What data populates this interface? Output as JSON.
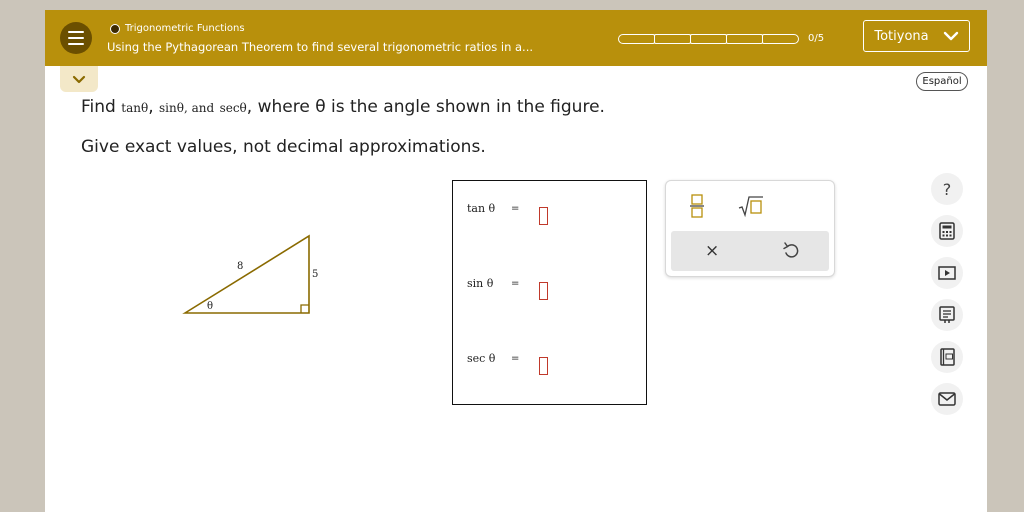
{
  "header": {
    "topic": "Trigonometric Functions",
    "lesson_title": "Using the Pythagorean Theorem to find several trigonometric ratios in a...",
    "progress_text": "0/5",
    "progress_segments": 5,
    "progress_completed": 0,
    "user_name": "Totiyona"
  },
  "language_button": "Español",
  "question": {
    "find": "Find",
    "tan": "tanθ",
    "sep1": ",",
    "sin": "sinθ",
    "and": ", and",
    "sec": "secθ",
    "rest": ", where θ is the angle shown in the figure.",
    "line2": "Give exact values, not decimal approximations."
  },
  "figure": {
    "hypotenuse_label": "8",
    "opposite_label": "5",
    "angle_label": "θ"
  },
  "answers": {
    "tan_label": "tan θ",
    "sin_label": "sin θ",
    "sec_label": "sec θ",
    "equals": "="
  },
  "keypad": {
    "clear_symbol": "×"
  },
  "sidebar": {
    "help_symbol": "?"
  },
  "colors": {
    "header_bg": "#b8900c",
    "input_border": "#c0392b",
    "triangle_stroke": "#8a6a00"
  }
}
